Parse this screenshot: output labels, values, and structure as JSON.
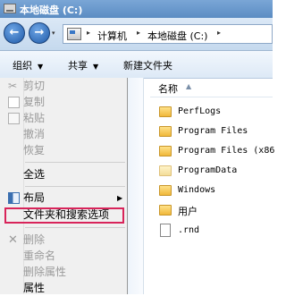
{
  "window": {
    "title": "本地磁盘 (C:)"
  },
  "address": {
    "breadcrumbs": [
      "计算机",
      "本地磁盘 (C:)"
    ],
    "separator": "▸",
    "dropdown_glyph": "▾"
  },
  "toolbar": {
    "organize": "组织",
    "share": "共享",
    "new_folder": "新建文件夹",
    "caret": "▼"
  },
  "menu": {
    "items": [
      {
        "label": "剪切",
        "enabled": false,
        "icon": "cut-icon"
      },
      {
        "label": "复制",
        "enabled": false,
        "icon": "copy-icon"
      },
      {
        "label": "粘贴",
        "enabled": false,
        "icon": "paste-icon"
      },
      {
        "label": "撤消",
        "enabled": false
      },
      {
        "label": "恢复",
        "enabled": false
      },
      {
        "label": "全选",
        "enabled": true
      },
      {
        "label": "布局",
        "enabled": true,
        "icon": "layout-icon",
        "submenu": true
      },
      {
        "label": "文件夹和搜索选项",
        "enabled": true,
        "highlighted": true
      },
      {
        "label": "删除",
        "enabled": false,
        "icon": "delete-icon"
      },
      {
        "label": "重命名",
        "enabled": false
      },
      {
        "label": "删除属性",
        "enabled": false
      },
      {
        "label": "属性",
        "enabled": true
      }
    ],
    "submenu_arrow": "▶",
    "highlight_color": "#d8245a"
  },
  "file_list": {
    "column_header": "名称",
    "sort_glyph": "▲",
    "files": [
      {
        "name": "PerfLogs",
        "type": "folder"
      },
      {
        "name": "Program Files",
        "type": "folder"
      },
      {
        "name": "Program Files (x86",
        "type": "folder"
      },
      {
        "name": "ProgramData",
        "type": "folder-hidden"
      },
      {
        "name": "Windows",
        "type": "folder"
      },
      {
        "name": "用户",
        "type": "folder"
      },
      {
        "name": ".rnd",
        "type": "file"
      }
    ]
  }
}
